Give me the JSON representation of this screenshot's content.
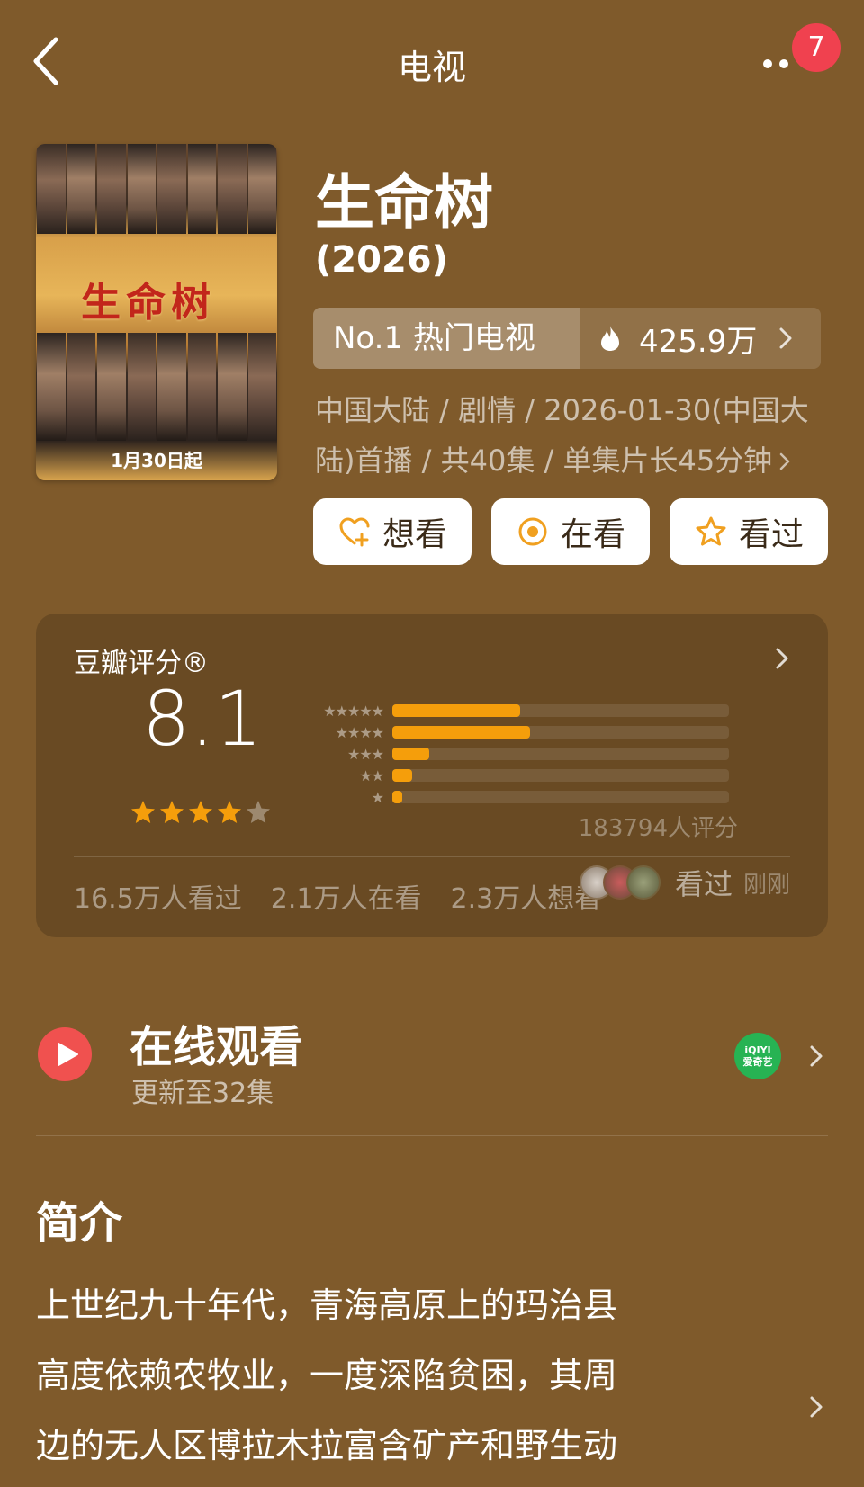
{
  "header": {
    "title": "电视",
    "notification_count": "7",
    "icons": {
      "back": "chevron-left-icon",
      "more": "more-dots-icon"
    },
    "badge_color": "#f0414f"
  },
  "poster": {
    "title_art": "生命树",
    "date_text": "1月30日起"
  },
  "show": {
    "title": "生命树",
    "year": "(2026)",
    "rank_label": "No.1 热门电视",
    "heat_value": "425.9万",
    "meta_line1": "中国大陆 / 剧情 / 2026-01-30(中国大",
    "meta_line2": "陆)首播 / 共40集 / 单集片长45分钟"
  },
  "actions": {
    "want": "想看",
    "watching": "在看",
    "watched": "看过"
  },
  "rating": {
    "label": "豆瓣评分®",
    "score": "8.1",
    "stars_filled": 4,
    "stars_total": 5,
    "distribution": [
      {
        "stars": "★★★★★",
        "fraction": 0.38
      },
      {
        "stars": "★★★★",
        "fraction": 0.41
      },
      {
        "stars": "★★★",
        "fraction": 0.11
      },
      {
        "stars": "★★",
        "fraction": 0.06
      },
      {
        "stars": "★",
        "fraction": 0.03
      }
    ],
    "count_text": "183794人评分",
    "watched_text": "16.5万人看过",
    "watching_text": "2.1万人在看",
    "want_text": "2.3万人想看",
    "friend_action": "看过",
    "friend_time": "刚刚",
    "accent_color": "#f59e0b"
  },
  "online": {
    "title": "在线观看",
    "subtitle": "更新至32集",
    "provider_logo": "iQIYI\n爱奇艺",
    "play_color": "#f0514f"
  },
  "synopsis": {
    "title": "简介",
    "lines": [
      "上世纪九十年代，青海高原上的玛治县",
      "高度依赖农牧业，一度深陷贫困，其周",
      "边的无人区博拉木拉富含矿产和野生动"
    ]
  }
}
